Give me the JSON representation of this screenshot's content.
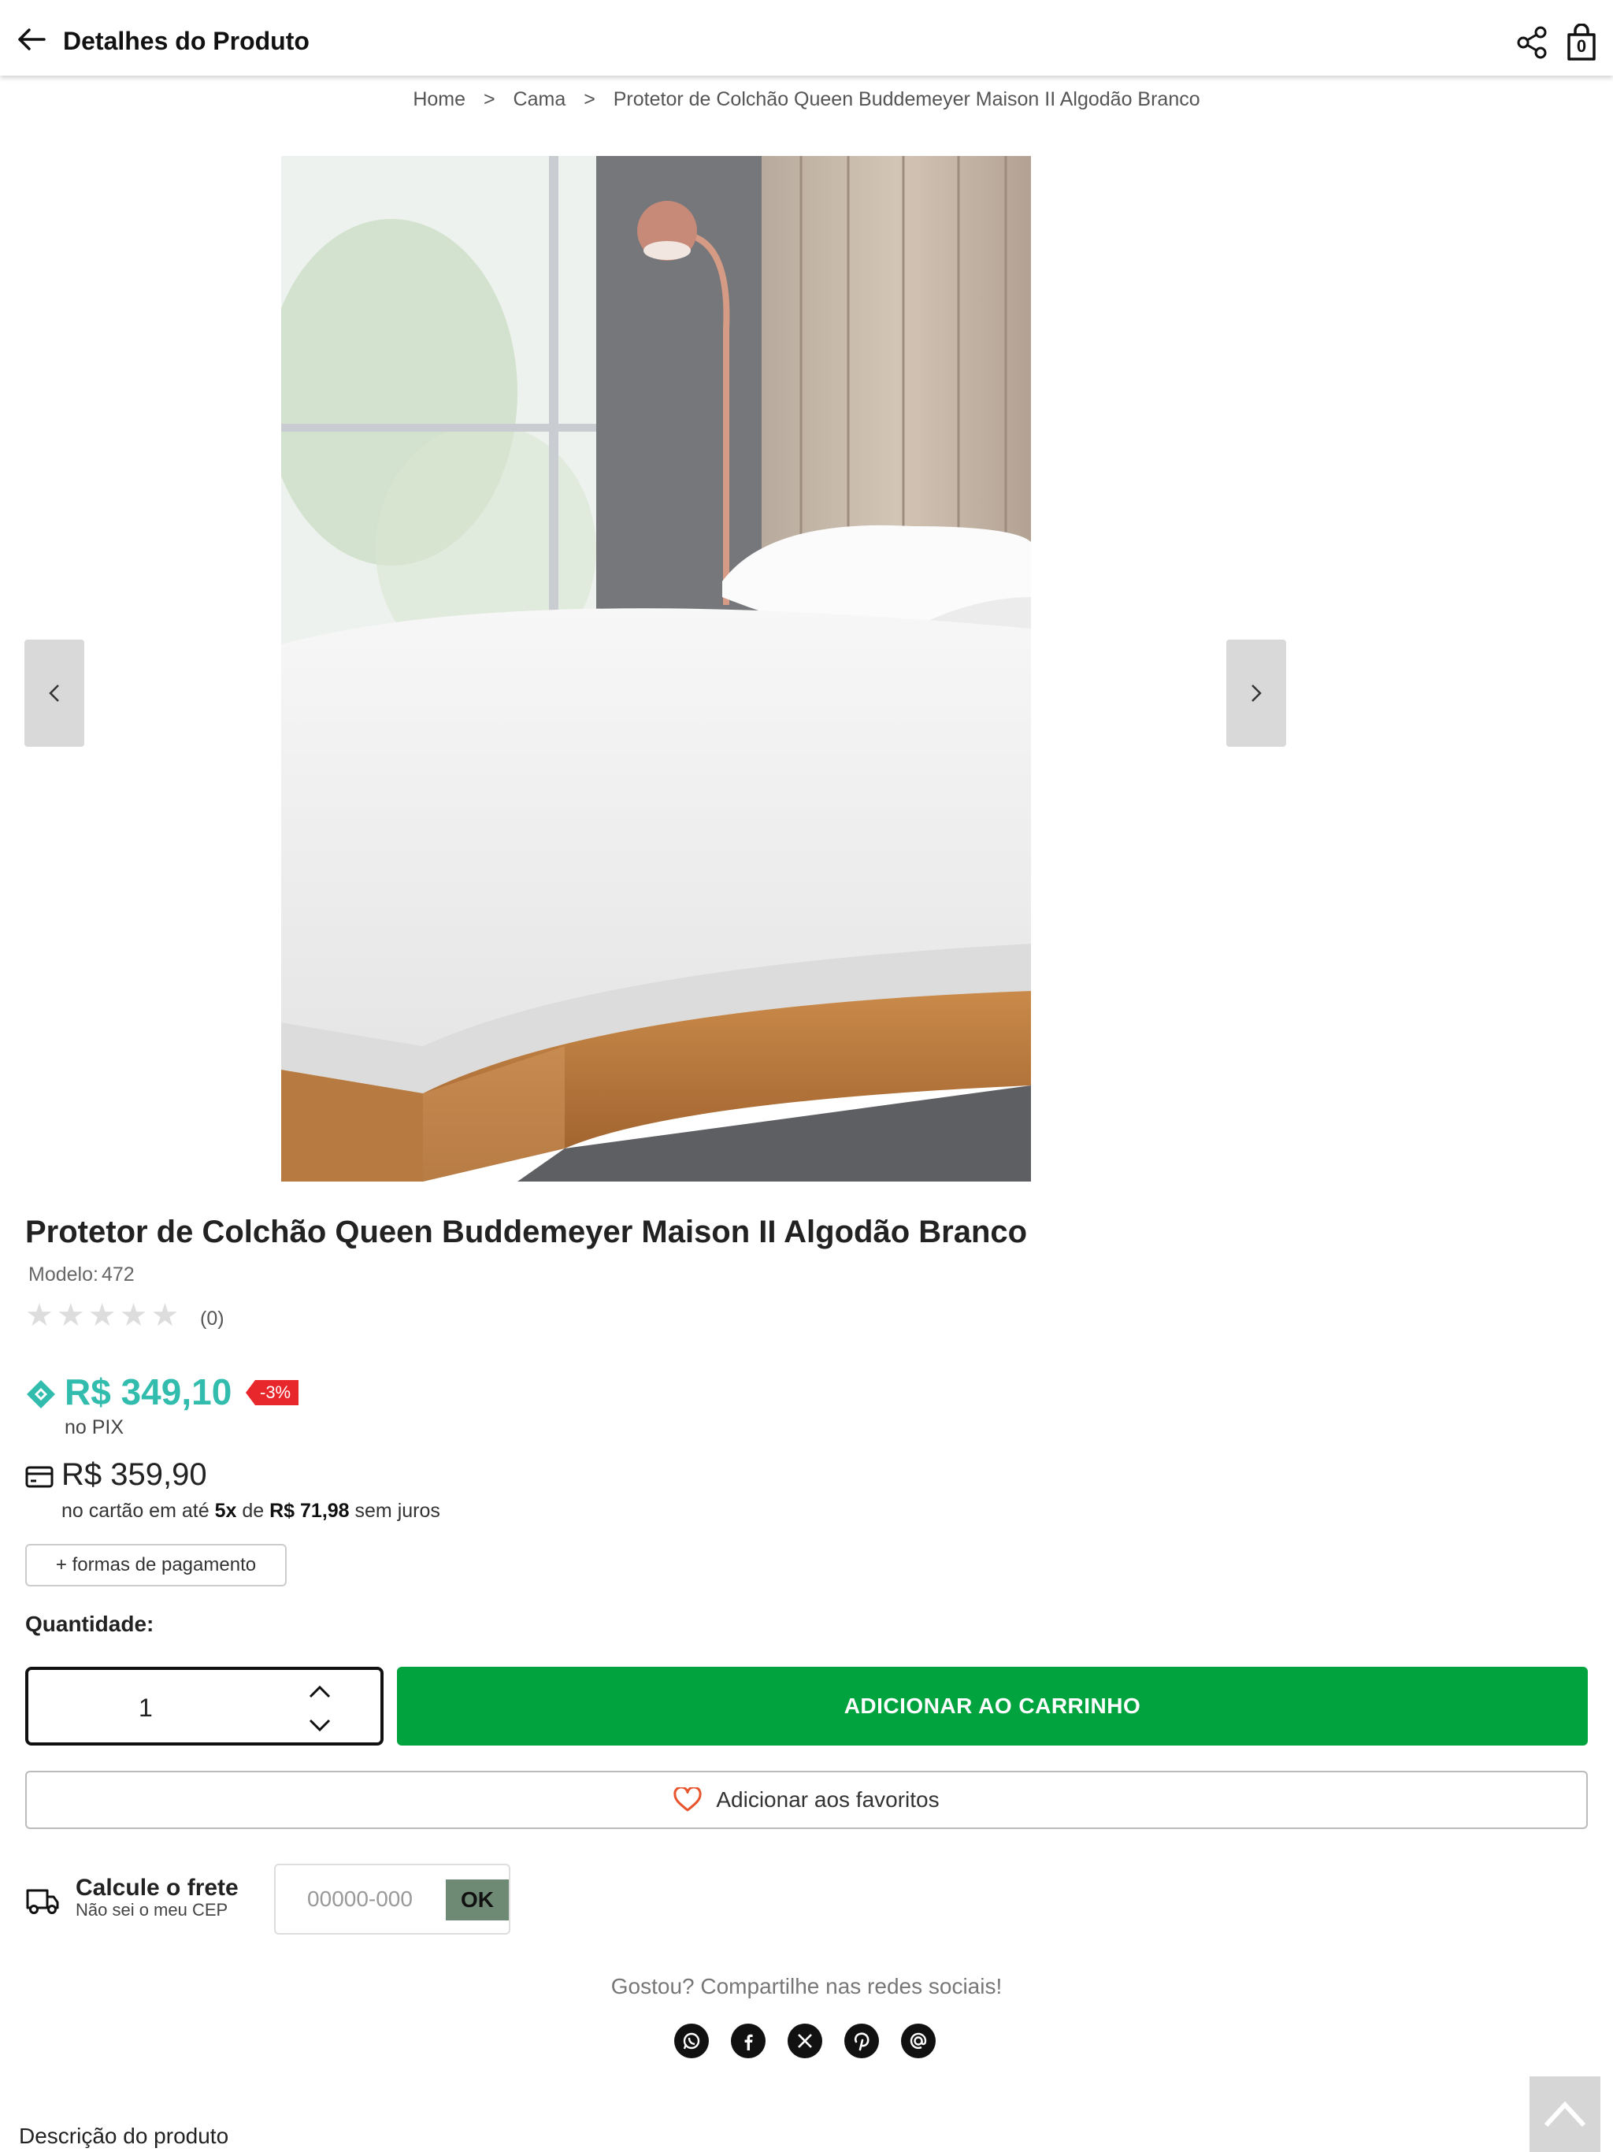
{
  "header": {
    "title": "Detalhes do Produto",
    "cart_count": "0"
  },
  "breadcrumb": {
    "items": [
      "Home",
      "Cama",
      "Protetor de Colchão Queen Buddemeyer Maison II Algodão Branco"
    ],
    "separator": ">"
  },
  "product": {
    "title": "Protetor de Colchão Queen Buddemeyer Maison II Algodão Branco",
    "model_label": "Modelo:",
    "model_value": "472",
    "rating": 0,
    "review_count": "(0)",
    "pix_price": "R$ 349,10",
    "discount": "-3%",
    "pix_label": "no PIX",
    "card_price": "R$ 359,90",
    "installments": {
      "prefix": "no cartão em até",
      "count": "5x",
      "middle": "de",
      "value": "R$ 71,98",
      "suffix": "sem juros"
    },
    "payment_options_label": "+ formas de pagamento"
  },
  "purchase": {
    "quantity_label": "Quantidade:",
    "quantity_value": "1",
    "add_to_cart_label": "ADICIONAR AO CARRINHO",
    "favorite_label": "Adicionar aos favoritos"
  },
  "shipping": {
    "title": "Calcule o frete",
    "link": "Não sei o meu CEP",
    "cep_placeholder": "00000-000",
    "ok_label": "OK"
  },
  "share": {
    "text": "Gostou? Compartilhe nas redes sociais!",
    "networks": [
      "whatsapp-icon",
      "facebook-icon",
      "x-icon",
      "pinterest-icon",
      "email-icon"
    ]
  },
  "description": {
    "label": "Descrição do produto"
  },
  "colors": {
    "pix": "#32bcad",
    "add_to_cart": "#01a33f",
    "discount": "#e8272c",
    "ok_button": "#6f8a74",
    "favorite_heart": "#e8542c"
  }
}
